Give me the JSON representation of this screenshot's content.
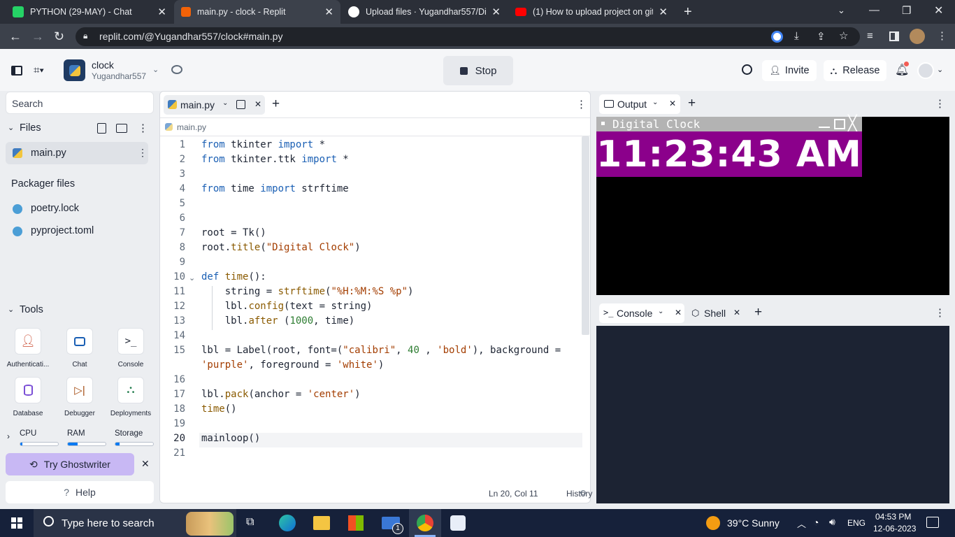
{
  "browser": {
    "tabs": [
      {
        "title": "PYTHON (29-MAY) - Chat",
        "icon": "whatsapp-icon",
        "color": "#25d366"
      },
      {
        "title": "main.py - clock - Replit",
        "icon": "replit-icon",
        "color": "#f26207"
      },
      {
        "title": "Upload files · Yugandhar557/Digi",
        "icon": "github-icon",
        "color": "#ffffff"
      },
      {
        "title": "(1) How to upload project on gith",
        "icon": "youtube-icon",
        "color": "#ff0000"
      }
    ],
    "url": "replit.com/@Yugandhar557/clock#main.py"
  },
  "header": {
    "repl_name": "clock",
    "owner": "Yugandhar557",
    "stop_label": "Stop",
    "invite_label": "Invite",
    "release_label": "Release"
  },
  "sidebar": {
    "search_placeholder": "Search",
    "files_label": "Files",
    "files": [
      "main.py"
    ],
    "packager_label": "Packager files",
    "packager_files": [
      "poetry.lock",
      "pyproject.toml"
    ],
    "tools_label": "Tools",
    "tools": [
      {
        "label": "Authenticati...",
        "icon": "user-icon"
      },
      {
        "label": "Chat",
        "icon": "chat-icon"
      },
      {
        "label": "Console",
        "icon": "terminal-icon"
      },
      {
        "label": "Database",
        "icon": "database-icon"
      },
      {
        "label": "Debugger",
        "icon": "debugger-icon"
      },
      {
        "label": "Deployments",
        "icon": "deployments-icon"
      }
    ],
    "resources": [
      {
        "label": "CPU",
        "level": 0.02
      },
      {
        "label": "RAM",
        "level": 0.25
      },
      {
        "label": "Storage",
        "level": 0.12
      }
    ],
    "ghostwriter_label": "Try Ghostwriter",
    "help_label": "Help"
  },
  "editor": {
    "tab_label": "main.py",
    "breadcrumb": "main.py",
    "line_numbers": [
      "1",
      "2",
      "3",
      "4",
      "5",
      "6",
      "7",
      "8",
      "9",
      "10",
      "11",
      "12",
      "13",
      "14",
      "15",
      "",
      "16",
      "17",
      "18",
      "19",
      "20",
      "21"
    ],
    "code": [
      "from tkinter import *",
      "from tkinter.ttk import *",
      "",
      "from time import strftime",
      "",
      "",
      "root = Tk()",
      "root.title(\"Digital Clock\")",
      "",
      "def time():",
      "    string = strftime(\"%H:%M:%S %p\")",
      "    lbl.config(text = string)",
      "    lbl.after (1000, time)",
      "",
      "lbl = Label(root, font=(\"calibri\", 40 , 'bold'), background =",
      "'purple', foreground = 'white')",
      "",
      "lbl.pack(anchor = 'center')",
      "time()",
      "",
      "mainloop()",
      ""
    ],
    "status": "Ln 20, Col 11",
    "history_label": "History"
  },
  "output": {
    "tab_label": "Output",
    "window_title": "Digital Clock",
    "clock_text": "11:23:43 AM",
    "clock_bg": "#8b008b"
  },
  "console": {
    "tab_console": "Console",
    "tab_shell": "Shell"
  },
  "taskbar": {
    "search_placeholder": "Type here to search",
    "weather": "39°C  Sunny",
    "language": "ENG",
    "time": "04:53 PM",
    "date": "12-06-2023",
    "mail_badge": "1"
  },
  "colors": {
    "accent": "#0079f2",
    "ghostwriter_bg": "#c8b8f4",
    "output_bg": "#000000",
    "console_bg": "#1c2333"
  }
}
